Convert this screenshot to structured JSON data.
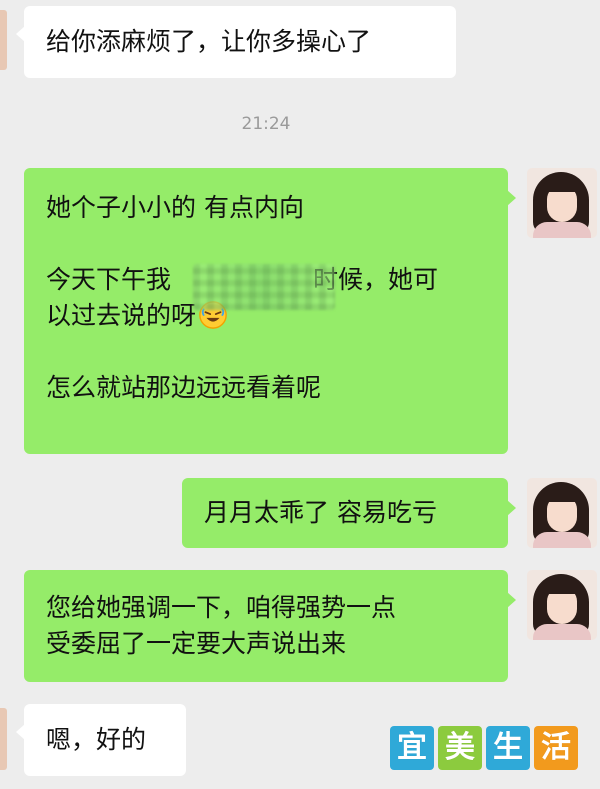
{
  "chat": {
    "msg1": {
      "text": "给你添麻烦了，让你多操心了"
    },
    "time": "21:24",
    "msg2": {
      "line1": "她个子小小的  有点内向",
      "line2_start": "今天下午",
      "line2_visible_start_char": "我",
      "line2_visible_end": "时候，她可",
      "line3": "以过去说的呀"
    },
    "msg2b": {
      "line1": "怎么就站那边远远看着呢"
    },
    "msg3": {
      "text": "月月太乖了  容易吃亏"
    },
    "msg4": {
      "line1": "您给她强调一下，咱得强势一点",
      "line2": "受委屈了一定要大声说出来"
    },
    "msg5": {
      "text": "嗯，好的"
    }
  },
  "watermark": {
    "chars": [
      "宜",
      "美",
      "生",
      "活"
    ],
    "colors": [
      "#2fa9d8",
      "#8ccb3e",
      "#2fa9d8",
      "#f29a1d"
    ]
  },
  "icons": {
    "laugh_emoji": "rolling-on-floor-laughing-emoji"
  }
}
